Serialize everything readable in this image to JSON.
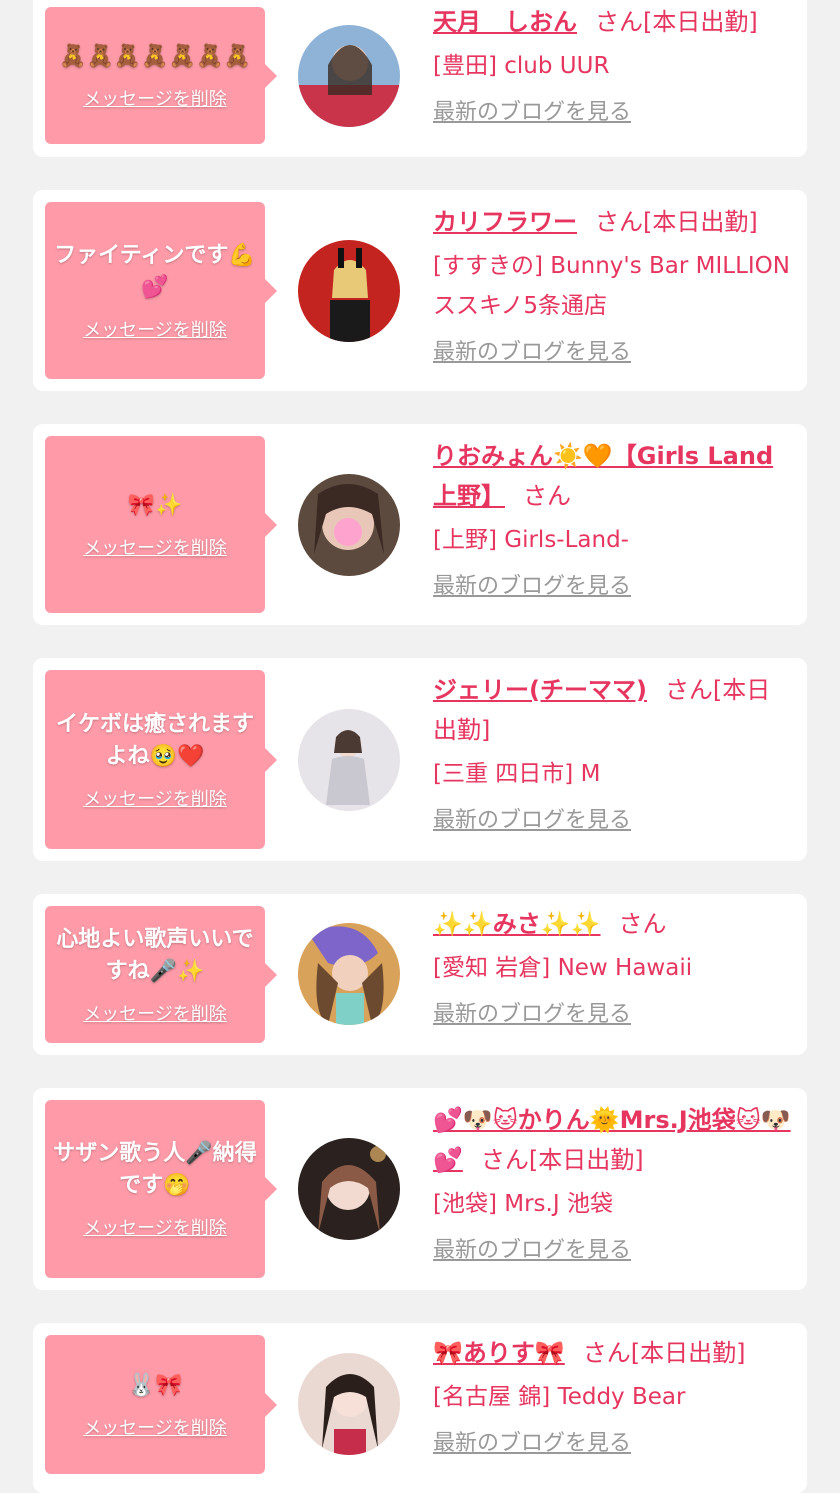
{
  "delete_label": "メッセージを削除",
  "blog_label": "最新のブログを見る",
  "san_suffix": "さん",
  "colors": {
    "bubble": "#ff9ba9",
    "accent": "#e6355f",
    "link_gray": "#999999",
    "background": "#f1f1f1"
  },
  "items": [
    {
      "message": "🧸🧸🧸🧸🧸🧸🧸",
      "name": "天月　しおん",
      "status": "さん[本日出勤]",
      "shop": "[豊田] club UUR"
    },
    {
      "message": "ファイティンです💪💕",
      "name": "カリフラワー",
      "status": "さん[本日出勤]",
      "shop": "[すすきの] Bunny's Bar MILLION ススキノ5条通店"
    },
    {
      "message": "🎀✨",
      "name": "りおみょん☀️🧡【Girls Land 上野】",
      "status": "さん",
      "shop": "[上野] Girls-Land-"
    },
    {
      "message": "イケボは癒されますよね🥹❤️",
      "name": "ジェリー(チーママ)",
      "status": "さん[本日出勤]",
      "shop": "[三重 四日市] M"
    },
    {
      "message": "心地よい歌声いいですね🎤✨",
      "name": "✨✨みさ✨✨",
      "status": "さん",
      "shop": "[愛知 岩倉] New Hawaii"
    },
    {
      "message": "サザン歌う人🎤納得です🤭",
      "name": "💕🐶🐱かりん🌞Mrs.J池袋🐱🐶💕",
      "status": "さん[本日出勤]",
      "shop": "[池袋] Mrs.J 池袋"
    },
    {
      "message": "🐰🎀",
      "name": "🎀ありす🎀",
      "status": "さん[本日出勤]",
      "shop": "[名古屋 錦] Teddy Bear"
    }
  ]
}
